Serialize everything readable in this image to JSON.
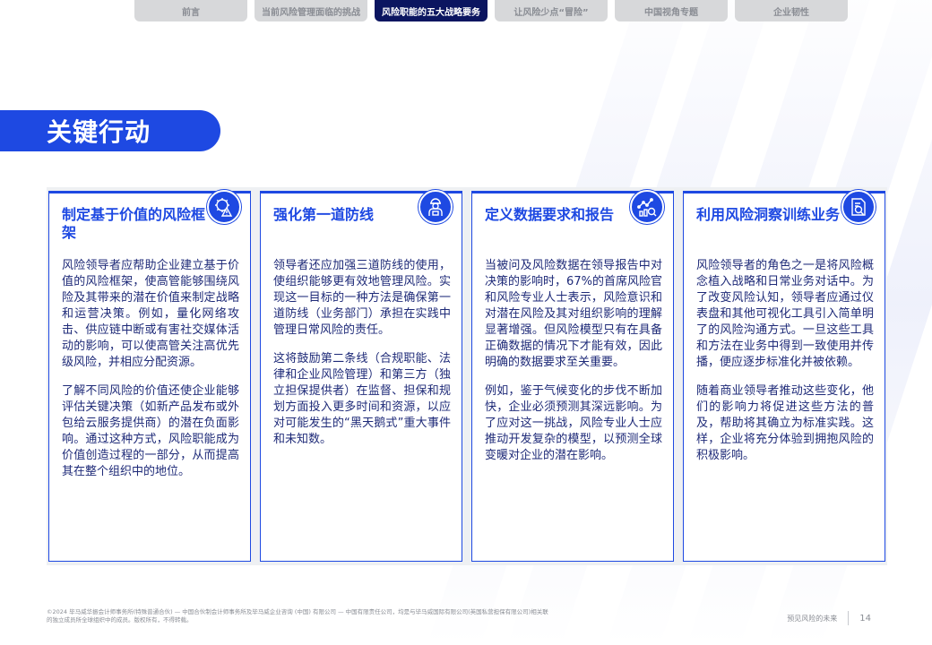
{
  "nav": {
    "tabs": [
      {
        "label": "前言",
        "active": false
      },
      {
        "label": "当前风险管理面临的挑战",
        "active": false
      },
      {
        "label": "风险职能的五大战略要务",
        "active": true
      },
      {
        "label": "让风险少点“冒险”",
        "active": false
      },
      {
        "label": "中国视角专题",
        "active": false
      },
      {
        "label": "企业韧性",
        "active": false
      }
    ]
  },
  "heading": "关键行动",
  "cards": [
    {
      "title": "制定基于价值的风险框架",
      "icon": "gear-warning-icon",
      "paragraphs": [
        "风险领导者应帮助企业建立基于价值的风险框架，使高管能够围绕风险及其带来的潜在价值来制定战略和运营决策。例如，量化网络攻击、供应链中断或有害社交媒体活动的影响，可以使高管关注高优先级风险，并相应分配资源。",
        "了解不同风险的价值还使企业能够评估关键决策（如新产品发布或外包给云服务提供商）的潜在负面影响。通过这种方式，风险职能成为价值创造过程的一部分，从而提高其在整个组织中的地位。"
      ]
    },
    {
      "title": "强化第一道防线",
      "icon": "worker-icon",
      "paragraphs": [
        "领导者还应加强三道防线的使用，使组织能够更有效地管理风险。实现这一目标的一种方法是确保第一道防线（业务部门）承担在实践中管理日常风险的责任。",
        "这将鼓励第二条线（合规职能、法律和企业风险管理）和第三方（独立担保提供者）在监督、担保和规划方面投入更多时间和资源，以应对可能发生的“黑天鹅式”重大事件和未知数。"
      ]
    },
    {
      "title": "定义数据要求和报告",
      "icon": "data-chart-icon",
      "paragraphs": [
        "当被问及风险数据在领导报告中对决策的影响时，67%的首席风险官和风险专业人士表示，风险意识和对潜在风险及其对组织影响的理解显著增强。但风险模型只有在具备正确数据的情况下才能有效，因此明确的数据要求至关重要。",
        "例如，鉴于气候变化的步伐不断加快，企业必须预测其深远影响。为了应对这一挑战，风险专业人士应推动开发复杂的模型，以预测全球变暖对企业的潜在影响。"
      ]
    },
    {
      "title": "利用风险洞察训练业务",
      "icon": "document-search-icon",
      "paragraphs": [
        "风险领导者的角色之一是将风险概念植入战略和日常业务对话中。为了改变风险认知，领导者应通过仪表盘和其他可视化工具引入简单明了的风险沟通方式。一旦这些工具和方法在业务中得到一致使用并传播，便应逐步标准化并被依赖。",
        "随着商业领导者推动这些变化，他们的影响力将促进这些方法的普及，帮助将其确立为标准实践。这样，企业将充分体验到拥抱风险的积极影响。"
      ]
    }
  ],
  "footer": {
    "legal": "©2024 毕马威华振会计师事务所(特殊普通合伙) — 中国合伙制会计师事务所及毕马威企业咨询 (中国) 有限公司 — 中国有限责任公司，均是与毕马威国际有限公司(英国私营担保有限公司)相关联的独立成员所全球组织中的成员。版权所有，不得转载。",
    "report_title": "预见风险的未来",
    "page_number": "14"
  }
}
